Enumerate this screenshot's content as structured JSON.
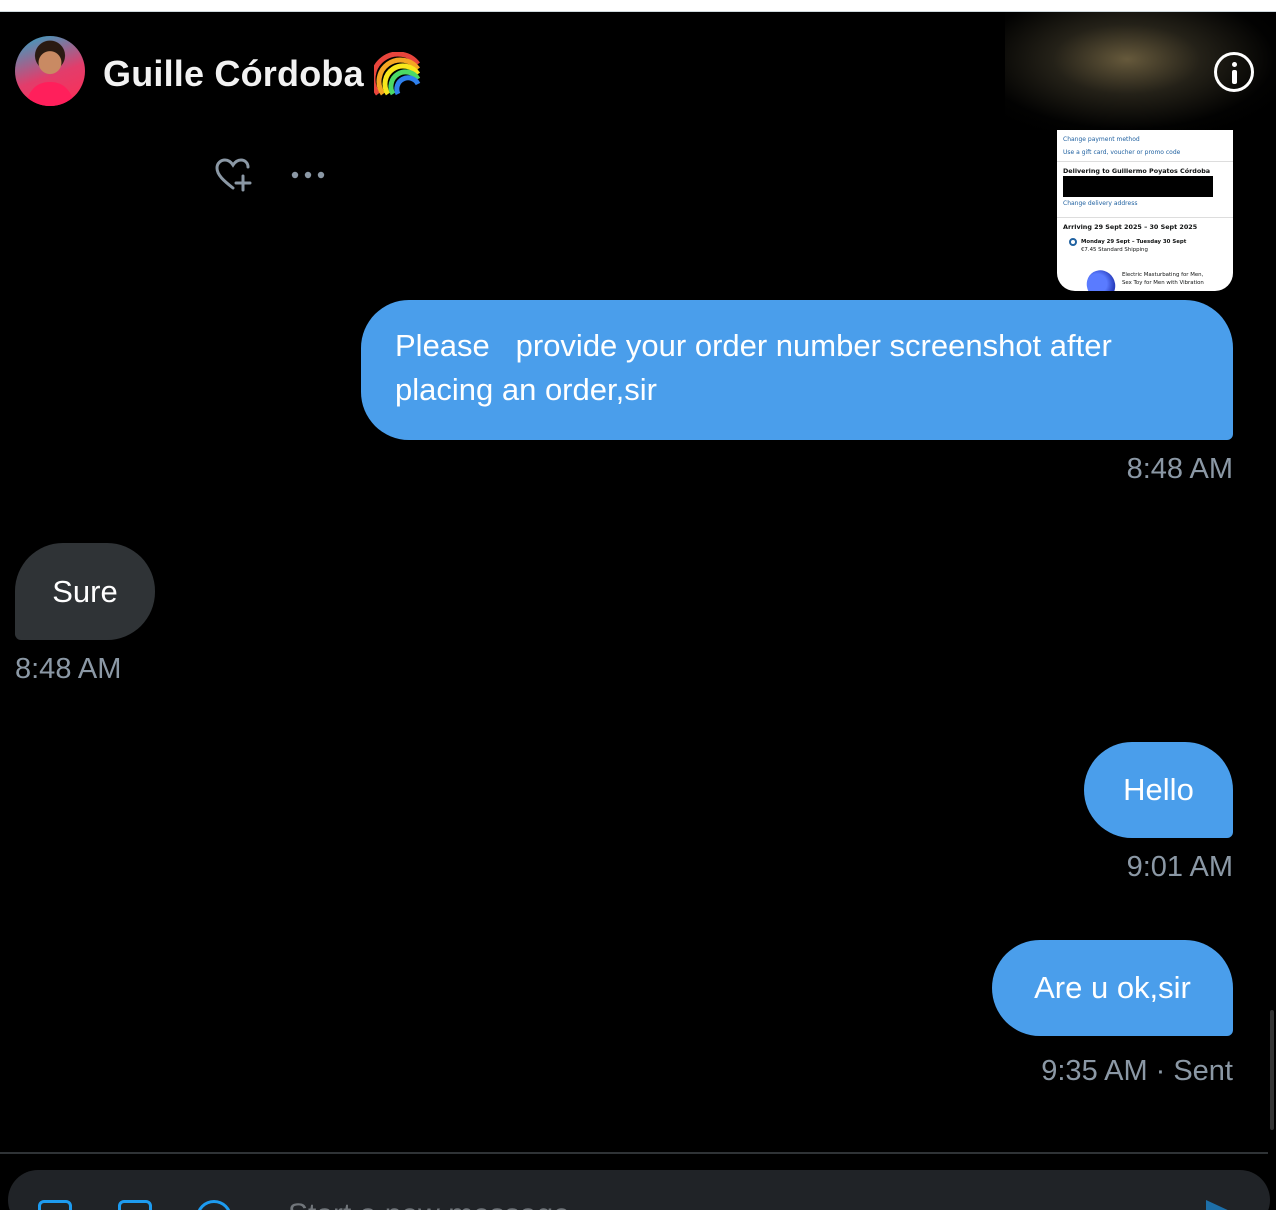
{
  "header": {
    "contact_name": "Guille Córdoba",
    "name_emoji": "rainbow-emoji",
    "info_icon": "info-icon"
  },
  "message_actions": {
    "react_icon": "heart-plus-icon",
    "more_icon": "more-horizontal-icon"
  },
  "attachment": {
    "lines": {
      "change_payment": "Change payment method",
      "gift_card": "Use a gift card, voucher or promo code",
      "delivering": "Delivering to Guillermo Poyatos Córdoba",
      "change_address": "Change delivery address",
      "arriving": "Arriving 29 Sept 2025 – 30 Sept 2025",
      "option_date": "Monday 29 Sept – Tuesday 30 Sept",
      "option_price": "€7.45 Standard Shipping",
      "product_line1": "Electric Masturbating for Men,",
      "product_line2": "Sex Toy for Men with Vibration"
    }
  },
  "messages": [
    {
      "direction": "outgoing",
      "text": "Please   provide your order number screenshot after placing an order,sir",
      "time": "8:48 AM"
    },
    {
      "direction": "incoming",
      "text": "Sure",
      "time": "8:48 AM"
    },
    {
      "direction": "outgoing",
      "text": "Hello",
      "time": "9:01 AM"
    },
    {
      "direction": "outgoing",
      "text": "Are u ok,sir",
      "time": "9:35 AM",
      "status_sep": "·",
      "status": "Sent"
    }
  ],
  "composer": {
    "placeholder": "Start a new message",
    "icons": [
      "image-icon",
      "gif-icon",
      "emoji-icon",
      "send-icon"
    ]
  },
  "colors": {
    "outgoing_bubble": "#4a9eeb",
    "incoming_bubble": "#2f3336",
    "background": "#000000",
    "timestamp": "#8b98a5"
  }
}
